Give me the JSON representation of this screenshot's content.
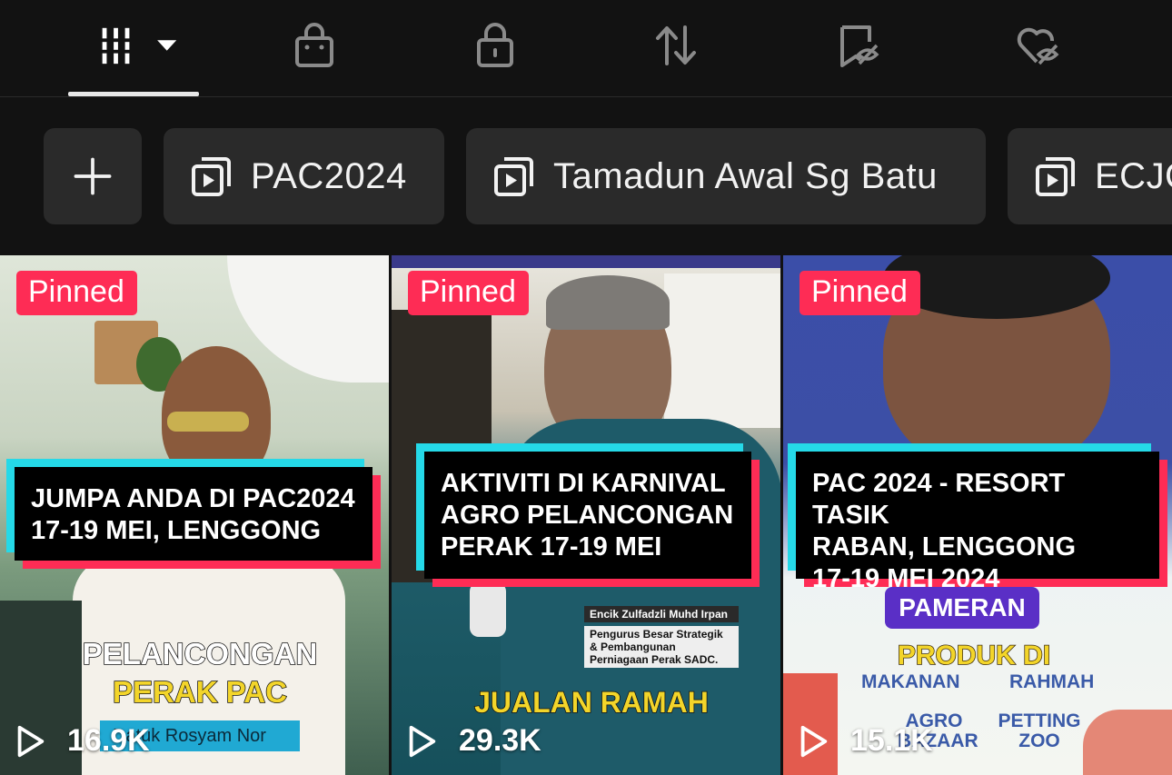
{
  "tabs": [
    {
      "name": "videos-grid-tab",
      "icon": "grid-columns-icon",
      "active": true
    },
    {
      "name": "shop-tab",
      "icon": "shopping-bag-icon"
    },
    {
      "name": "private-tab",
      "icon": "lock-icon"
    },
    {
      "name": "reposts-tab",
      "icon": "repost-icon"
    },
    {
      "name": "favorites-hidden-tab",
      "icon": "bookmark-hidden-icon"
    },
    {
      "name": "liked-hidden-tab",
      "icon": "heart-hidden-icon"
    }
  ],
  "playlists": {
    "add_icon": "plus-icon",
    "items": [
      {
        "label": "PAC2024",
        "icon": "playlist-icon"
      },
      {
        "label": "Tamadun Awal Sg Batu",
        "icon": "playlist-icon"
      },
      {
        "label": "ECJO",
        "icon": "playlist-icon"
      }
    ]
  },
  "videos": [
    {
      "pinned_label": "Pinned",
      "caption_lines": [
        "JUMPA ANDA DI PAC2024",
        "17-19 MEI, LENGGONG"
      ],
      "overlay_lines": [
        "PELANCONGAN",
        "PERAK PAC"
      ],
      "overlay_sub": "Datuk Rosyam Nor",
      "views": "16.9K"
    },
    {
      "pinned_label": "Pinned",
      "caption_lines": [
        "AKTIVITI DI KARNIVAL",
        "AGRO PELANCONGAN",
        "PERAK 17-19 MEI"
      ],
      "overlay_lines": [
        "JUALAN RAMAH"
      ],
      "overlay_name": "Encik Zulfadzli Muhd Irpan",
      "overlay_role": "Pengurus Besar Strategik & Pembangunan Perniagaan Perak SADC.",
      "views": "29.3K"
    },
    {
      "pinned_label": "Pinned",
      "caption_lines": [
        "PAC 2024 - RESORT TASIK",
        "RABAN, LENGGONG",
        "17-19 MEI 2024"
      ],
      "overlay_banner": "PAMERAN",
      "overlay_lines": [
        "PRODUK DI"
      ],
      "overlay_items": [
        "MAKANAN",
        "RAHMAH",
        "AGRO BAZAAR",
        "PETTING ZOO"
      ],
      "views": "15.1K"
    }
  ],
  "colors": {
    "pinned": "#fe2c55",
    "cyan": "#25d9e8",
    "chip_bg": "#2a2a2a",
    "bg": "#121212"
  }
}
